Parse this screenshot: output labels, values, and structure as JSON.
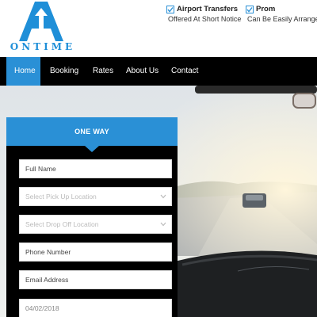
{
  "logo": {
    "text": "ONTIME",
    "brand_color": "#1f8fd8"
  },
  "features": [
    {
      "title": "Airport Transfers",
      "subtitle": "Offered At Short Notice",
      "icon": "check-icon"
    },
    {
      "title": "Prom",
      "subtitle": "Can Be Easily Arranged",
      "icon": "check-icon"
    }
  ],
  "nav": {
    "items": [
      {
        "label": "Home",
        "active": true
      },
      {
        "label": "Booking"
      },
      {
        "label": "Rates"
      },
      {
        "label": "About Us"
      },
      {
        "label": "Contact"
      }
    ],
    "active_color": "#2a90d6"
  },
  "booking_form": {
    "tab_label": "ONE WAY",
    "full_name": {
      "placeholder": "Full Name"
    },
    "pickup": {
      "placeholder": "Select Pick Up Location"
    },
    "dropoff": {
      "placeholder": "Select Drop Off Location"
    },
    "phone": {
      "placeholder": "Phone Number"
    },
    "email": {
      "placeholder": "Email Address"
    },
    "date": {
      "value": "04/02/2018"
    }
  }
}
